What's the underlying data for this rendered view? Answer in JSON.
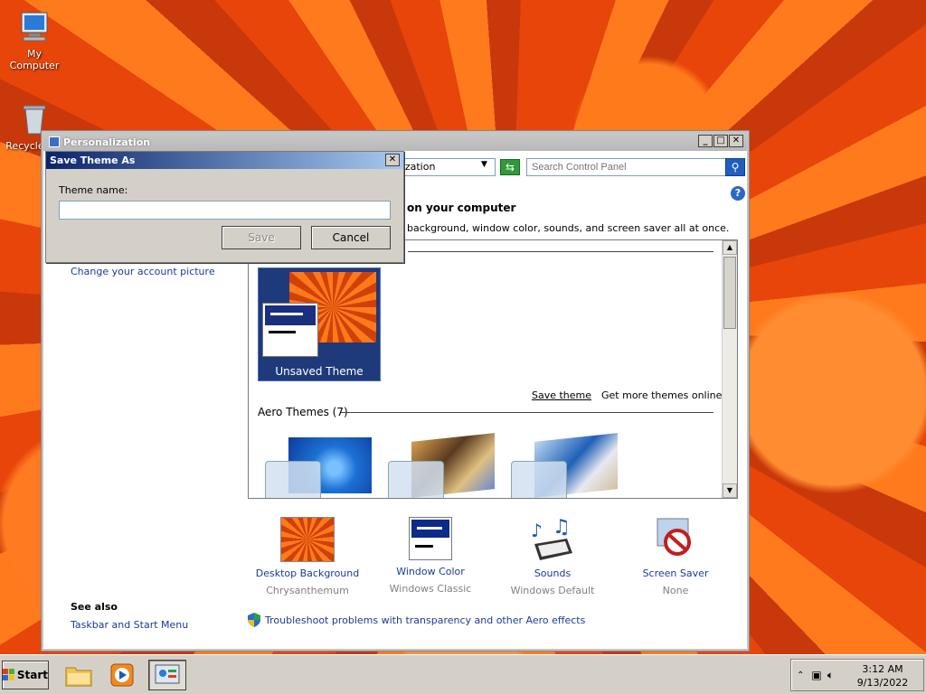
{
  "desktop": {
    "icons": [
      {
        "label": "My Computer"
      },
      {
        "label": "Recycle Bin"
      }
    ]
  },
  "window": {
    "title": "Personalization",
    "address_text": "alization",
    "search_placeholder": "Search Control Panel",
    "heading": "on your computer",
    "subheading": "background, window color, sounds, and screen saver all at once.",
    "left_links": [
      "Change your account picture"
    ],
    "see_also_label": "See also",
    "see_also_links": [
      "Taskbar and Start Menu"
    ],
    "themes": {
      "unsaved_label": "Unsaved Theme",
      "save_theme_link": "Save theme",
      "more_themes_link": "Get more themes online",
      "aero_heading": "Aero Themes (7)"
    },
    "bottom_items": [
      {
        "name": "Desktop Background",
        "sub": "Chrysanthemum"
      },
      {
        "name": "Window Color",
        "sub": "Windows Classic"
      },
      {
        "name": "Sounds",
        "sub": "Windows Default"
      },
      {
        "name": "Screen Saver",
        "sub": "None"
      }
    ],
    "troubleshoot_link": "Troubleshoot problems with transparency and other Aero effects"
  },
  "dialog": {
    "title": "Save Theme As",
    "label": "Theme name:",
    "input_value": "",
    "save_label": "Save",
    "cancel_label": "Cancel"
  },
  "taskbar": {
    "start_label": "Start",
    "time": "3:12 AM",
    "date": "9/13/2022"
  },
  "colors": {
    "link": "#1a3c9a",
    "dialog_title_start": "#0a246a",
    "dialog_title_end": "#a6caf0",
    "classic_face": "#d4d0c8"
  }
}
